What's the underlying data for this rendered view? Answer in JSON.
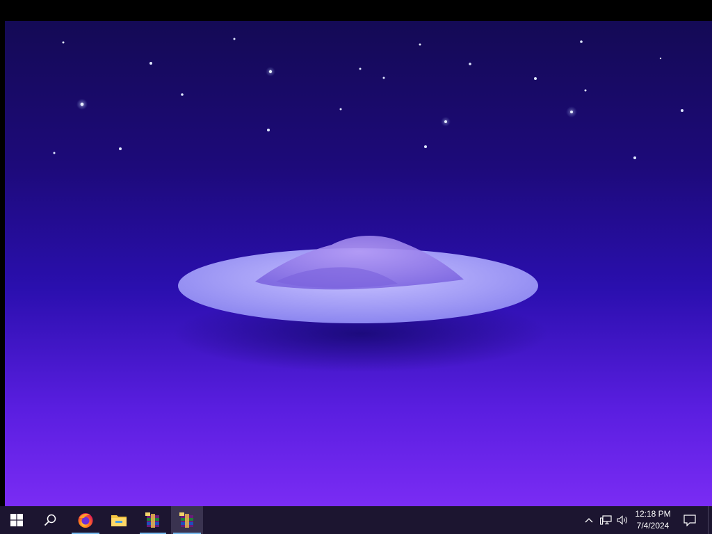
{
  "taskbar": {
    "start": {
      "icon": "windows-logo-icon"
    },
    "search": {
      "icon": "search-icon"
    },
    "pinned_apps": [
      {
        "name": "Firefox",
        "icon": "firefox-icon",
        "running": true
      },
      {
        "name": "File Explorer",
        "icon": "folder-icon",
        "running": false
      },
      {
        "name": "WinRAR",
        "icon": "winrar-icon",
        "running": true
      },
      {
        "name": "WinRAR",
        "icon": "winrar-icon",
        "running": true,
        "active": true
      }
    ],
    "tray": {
      "icons": [
        "chevron-up-icon",
        "network-icon",
        "volume-icon"
      ],
      "clock": {
        "time": "12:18 PM",
        "date": "7/4/2024"
      },
      "notification_icon": "action-center-icon"
    }
  },
  "colors": {
    "taskbar": "#1c1530",
    "accent": "#76b9ed",
    "wallpaper_top": "#140a55",
    "wallpaper_bottom": "#7a2cf4"
  }
}
